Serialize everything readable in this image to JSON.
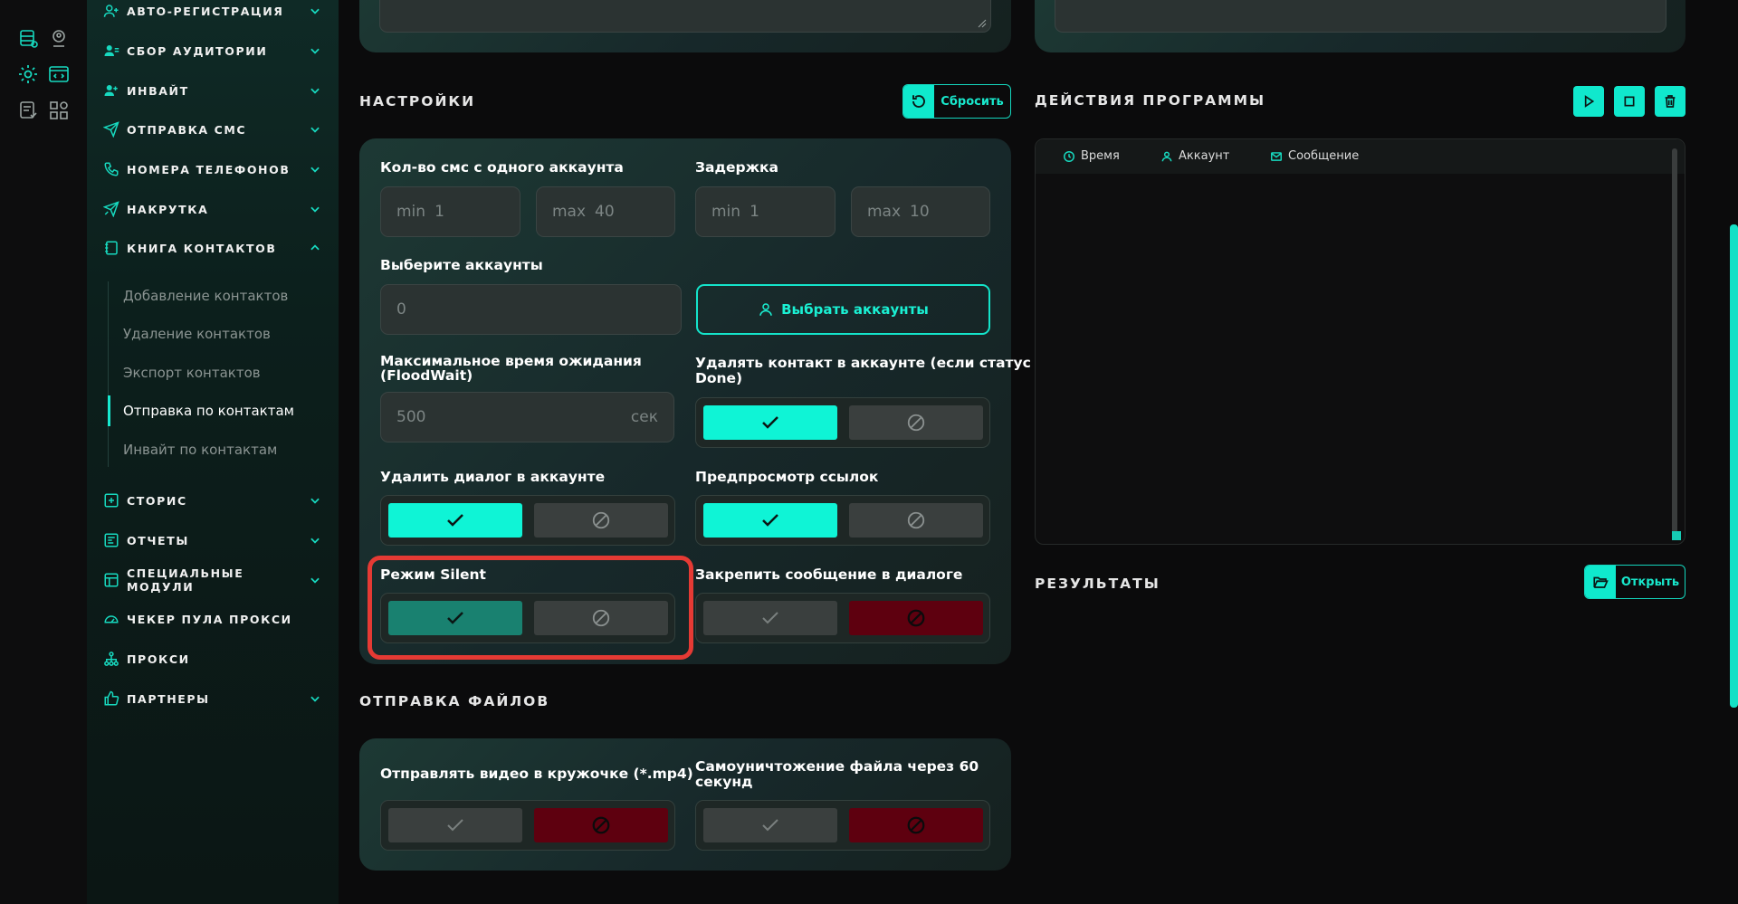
{
  "iconbar": {
    "icons": [
      "database-icon",
      "user-circle-icon",
      "gear-icon",
      "code-window-icon",
      "list-check-icon",
      "modules-icon"
    ]
  },
  "sidebar": {
    "items": [
      {
        "label": "АВТО-РЕГИСТРАЦИЯ",
        "icon": "user-plus-icon",
        "expanded": false
      },
      {
        "label": "СБОР АУДИТОРИИ",
        "icon": "users-icon",
        "expanded": false
      },
      {
        "label": "ИНВАЙТ",
        "icon": "user-add-icon",
        "expanded": false
      },
      {
        "label": "ОТПРАВКА СМС",
        "icon": "send-icon",
        "expanded": false
      },
      {
        "label": "НОМЕРА ТЕЛЕФОНОВ",
        "icon": "phone-icon",
        "expanded": false
      },
      {
        "label": "НАКРУТКА",
        "icon": "boost-icon",
        "expanded": false
      },
      {
        "label": "КНИГА КОНТАКТОВ",
        "icon": "book-icon",
        "expanded": true
      },
      {
        "label": "СТОРИС",
        "icon": "plus-square-icon",
        "expanded": false
      },
      {
        "label": "ОТЧЕТЫ",
        "icon": "report-icon",
        "expanded": false
      },
      {
        "label": "СПЕЦИАЛЬНЫЕ МОДУЛИ",
        "icon": "modules-icon",
        "expanded": false
      },
      {
        "label": "ЧЕКЕР ПУЛА ПРОКСИ",
        "icon": "gauge-icon",
        "expanded": false
      },
      {
        "label": "ПРОКСИ",
        "icon": "network-icon",
        "expanded": false
      },
      {
        "label": "ПАРТНЕРЫ",
        "icon": "thumb-up-icon",
        "expanded": false
      }
    ],
    "sub_items": [
      {
        "label": "Добавление контактов",
        "active": false
      },
      {
        "label": "Удаление контактов",
        "active": false
      },
      {
        "label": "Экспорт контактов",
        "active": false
      },
      {
        "label": "Отправка по контактам",
        "active": true
      },
      {
        "label": "Инвайт по контактам",
        "active": false
      }
    ]
  },
  "settings": {
    "title": "НАСТРОЙКИ",
    "reset_label": "Сбросить",
    "sms_per_account": {
      "label": "Кол-во смс с одного аккаунта",
      "min_ph": "min",
      "min_val": "1",
      "max_ph": "max",
      "max_val": "40"
    },
    "delay": {
      "label": "Задержка",
      "min_ph": "min",
      "min_val": "1",
      "max_ph": "max",
      "max_val": "10"
    },
    "accounts": {
      "label": "Выберите аккаунты",
      "value": "0",
      "button": "Выбрать аккаунты"
    },
    "floodwait": {
      "label_line1": "Максимальное время ожидания",
      "label_line2": "(FloodWait)",
      "value": "500",
      "unit": "сек"
    },
    "delete_contact": {
      "label_line1": "Удалять контакт в аккаунте (если статус",
      "label_line2": "Done)",
      "state": "on"
    },
    "delete_dialog": {
      "label": "Удалить диалог в аккаунте",
      "state": "on"
    },
    "link_preview": {
      "label": "Предпросмотр ссылок",
      "state": "on"
    },
    "silent_mode": {
      "label": "Режим Silent",
      "state": "on"
    },
    "pin_message": {
      "label": "Закрепить сообщение в диалоге",
      "state": "off"
    }
  },
  "files": {
    "title": "ОТПРАВКА ФАЙЛОВ",
    "video_circle": {
      "label": "Отправлять видео в кружочке (*.mp4)",
      "state": "off"
    },
    "self_destruct": {
      "label_line1": "Самоуничтожение файла через 60",
      "label_line2": "секунд",
      "state": "off"
    }
  },
  "program_actions": {
    "title": "ДЕЙСТВИЯ ПРОГРАММЫ",
    "columns": [
      "Время",
      "Аккаунт",
      "Сообщение"
    ]
  },
  "results": {
    "title": "РЕЗУЛЬТАТЫ",
    "open_label": "Открыть"
  },
  "colors": {
    "accent": "#0ff4d6",
    "danger": "#5e000f",
    "highlight": "#e53a34"
  }
}
